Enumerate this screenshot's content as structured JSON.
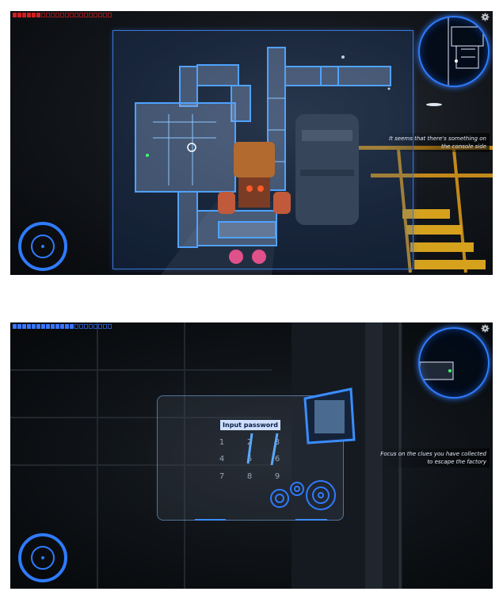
{
  "screens": [
    {
      "hud": {
        "health_filled": 6,
        "health_total": 21,
        "health_color": "#d02020",
        "hint_lines": [
          "It seems that there's something on",
          "the console side"
        ]
      }
    },
    {
      "hud": {
        "health_filled": 13,
        "health_total": 21,
        "health_color": "#3a74ff",
        "hint_lines": [
          "Focus on the clues you have collected",
          "to escape the factory"
        ]
      },
      "keypad": {
        "label": "Input password",
        "digits": [
          "1",
          "2",
          "3",
          "4",
          "5",
          "6",
          "7",
          "8",
          "9"
        ]
      }
    }
  ],
  "icons": {
    "settings": "gear-icon",
    "joystick": "virtual-joystick-icon",
    "minimap": "minimap-icon"
  },
  "colors": {
    "hud_blue": "#2f7bff",
    "map_blue": "#3a78d8",
    "rail_yellow": "#e0a51c"
  }
}
